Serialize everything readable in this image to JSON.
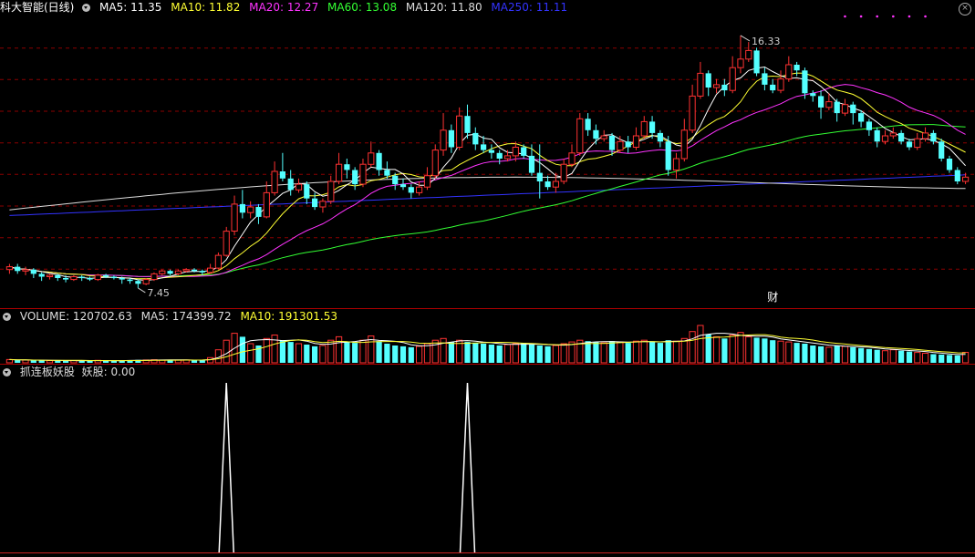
{
  "header": {
    "title": "科大智能(日线)",
    "ma": [
      {
        "label": "MA5: 11.35",
        "color": "#ffffff"
      },
      {
        "label": "MA10: 11.82",
        "color": "#ffff33"
      },
      {
        "label": "MA20: 12.27",
        "color": "#ff33ff"
      },
      {
        "label": "MA60: 13.08",
        "color": "#33ff33"
      },
      {
        "label": "MA120: 11.80",
        "color": "#dddddd"
      },
      {
        "label": "MA250: 11.11",
        "color": "#3333ff"
      }
    ],
    "close_symbol": "×"
  },
  "price_panel": {
    "high_marker": "16.33",
    "low_marker": "7.45",
    "event_marker": "财"
  },
  "volume_panel": {
    "label": "VOLUME: 120702.63",
    "ma5": "MA5: 174399.72",
    "ma10": "MA10: 191301.53"
  },
  "indicator_panel": {
    "name": "抓连板妖股",
    "value": "妖股: 0.00"
  },
  "colors": {
    "up": "#ff3232",
    "down": "#54ffff",
    "grid": "#8b0000",
    "ma5": "#ffffff",
    "ma10": "#ffff33",
    "ma20": "#ff33ff",
    "ma60": "#33ff33",
    "ma120": "#dddddd",
    "ma250": "#3333ff"
  },
  "chart_data": {
    "type": "candlestick",
    "ylim": [
      7.0,
      17.0
    ],
    "candles": [
      [
        8.1,
        8.2,
        8.3,
        7.95
      ],
      [
        8.2,
        8.05,
        8.3,
        7.95
      ],
      [
        8.05,
        8.1,
        8.2,
        7.9
      ],
      [
        8.1,
        7.95,
        8.15,
        7.8
      ],
      [
        7.95,
        7.85,
        8.0,
        7.7
      ],
      [
        7.85,
        7.9,
        7.95,
        7.75
      ],
      [
        7.9,
        7.8,
        7.95,
        7.7
      ],
      [
        7.8,
        7.75,
        7.9,
        7.65
      ],
      [
        7.75,
        7.85,
        7.9,
        7.7
      ],
      [
        7.85,
        7.8,
        7.9,
        7.7
      ],
      [
        7.8,
        7.75,
        7.85,
        7.7
      ],
      [
        7.75,
        7.9,
        7.95,
        7.7
      ],
      [
        7.9,
        7.85,
        7.95,
        7.8
      ],
      [
        7.85,
        7.8,
        7.9,
        7.75
      ],
      [
        7.8,
        7.75,
        7.85,
        7.6
      ],
      [
        7.75,
        7.7,
        7.8,
        7.6
      ],
      [
        7.7,
        7.6,
        7.75,
        7.45
      ],
      [
        7.6,
        7.75,
        7.8,
        7.55
      ],
      [
        7.75,
        7.95,
        8.0,
        7.7
      ],
      [
        7.95,
        8.05,
        8.1,
        7.9
      ],
      [
        8.05,
        7.95,
        8.1,
        7.9
      ],
      [
        7.95,
        8.05,
        8.1,
        7.9
      ],
      [
        8.05,
        8.1,
        8.15,
        8.0
      ],
      [
        8.1,
        8.05,
        8.15,
        8.0
      ],
      [
        8.05,
        8.0,
        8.1,
        7.9
      ],
      [
        8.0,
        8.15,
        8.3,
        7.95
      ],
      [
        8.15,
        8.6,
        8.7,
        8.1
      ],
      [
        8.6,
        9.45,
        9.6,
        8.55
      ],
      [
        9.45,
        10.4,
        10.7,
        9.3
      ],
      [
        10.4,
        10.1,
        10.9,
        9.9
      ],
      [
        10.1,
        10.3,
        10.5,
        9.9
      ],
      [
        10.3,
        9.95,
        10.4,
        9.7
      ],
      [
        9.95,
        10.8,
        11.2,
        9.9
      ],
      [
        10.8,
        11.55,
        11.9,
        10.7
      ],
      [
        11.55,
        11.3,
        12.2,
        11.2
      ],
      [
        11.3,
        10.9,
        11.6,
        10.7
      ],
      [
        10.9,
        11.1,
        11.3,
        10.8
      ],
      [
        11.1,
        10.6,
        11.2,
        10.4
      ],
      [
        10.6,
        10.3,
        10.8,
        10.2
      ],
      [
        10.3,
        10.5,
        10.6,
        10.1
      ],
      [
        10.5,
        11.2,
        11.4,
        10.4
      ],
      [
        11.2,
        11.8,
        12.2,
        11.1
      ],
      [
        11.8,
        11.6,
        12.0,
        11.3
      ],
      [
        11.6,
        11.1,
        11.7,
        10.9
      ],
      [
        11.1,
        11.8,
        12.0,
        11.0
      ],
      [
        11.8,
        12.2,
        12.6,
        11.7
      ],
      [
        12.2,
        11.6,
        12.3,
        11.4
      ],
      [
        11.6,
        11.4,
        11.9,
        11.3
      ],
      [
        11.4,
        11.1,
        11.5,
        10.9
      ],
      [
        11.1,
        11.0,
        11.3,
        10.9
      ],
      [
        11.0,
        10.8,
        11.1,
        10.6
      ],
      [
        10.8,
        11.0,
        11.2,
        10.7
      ],
      [
        11.0,
        11.4,
        11.7,
        10.9
      ],
      [
        11.4,
        12.3,
        12.5,
        11.3
      ],
      [
        12.3,
        13.0,
        13.6,
        12.1
      ],
      [
        13.0,
        12.4,
        13.2,
        12.2
      ],
      [
        12.4,
        13.5,
        13.8,
        12.3
      ],
      [
        13.5,
        12.9,
        13.9,
        12.7
      ],
      [
        12.9,
        12.5,
        13.1,
        12.3
      ],
      [
        12.5,
        12.3,
        12.8,
        12.2
      ],
      [
        12.3,
        12.2,
        12.5,
        12.0
      ],
      [
        12.2,
        12.0,
        12.3,
        11.8
      ],
      [
        12.0,
        12.1,
        12.3,
        11.9
      ],
      [
        12.1,
        12.4,
        12.6,
        11.9
      ],
      [
        12.4,
        12.1,
        12.5,
        12.0
      ],
      [
        12.1,
        11.5,
        12.5,
        11.4
      ],
      [
        11.5,
        11.2,
        12.5,
        10.6
      ],
      [
        11.2,
        11.0,
        11.4,
        10.9
      ],
      [
        11.0,
        11.2,
        11.5,
        10.8
      ],
      [
        11.2,
        11.8,
        12.0,
        11.1
      ],
      [
        11.8,
        12.2,
        12.5,
        11.7
      ],
      [
        12.2,
        13.4,
        13.6,
        12.1
      ],
      [
        13.4,
        13.0,
        13.6,
        12.8
      ],
      [
        13.0,
        12.7,
        13.2,
        12.5
      ],
      [
        12.7,
        12.8,
        13.0,
        12.6
      ],
      [
        12.8,
        12.3,
        12.9,
        12.1
      ],
      [
        12.3,
        12.6,
        12.8,
        12.2
      ],
      [
        12.6,
        12.4,
        12.8,
        12.2
      ],
      [
        12.4,
        12.8,
        13.1,
        12.3
      ],
      [
        12.8,
        13.3,
        13.5,
        12.7
      ],
      [
        13.3,
        12.9,
        13.5,
        12.7
      ],
      [
        12.9,
        12.6,
        13.0,
        12.4
      ],
      [
        12.6,
        11.6,
        12.8,
        11.4
      ],
      [
        11.6,
        12.0,
        12.2,
        11.3
      ],
      [
        12.0,
        13.0,
        13.4,
        11.9
      ],
      [
        13.0,
        14.2,
        14.6,
        12.9
      ],
      [
        14.2,
        15.0,
        15.4,
        14.1
      ],
      [
        15.0,
        14.5,
        15.1,
        14.2
      ],
      [
        14.5,
        14.6,
        14.8,
        14.3
      ],
      [
        14.6,
        14.4,
        14.8,
        14.2
      ],
      [
        14.4,
        15.2,
        15.6,
        14.3
      ],
      [
        15.2,
        15.5,
        16.33,
        15.0
      ],
      [
        15.5,
        15.8,
        16.1,
        15.4
      ],
      [
        15.8,
        15.0,
        15.9,
        14.9
      ],
      [
        15.0,
        14.6,
        15.2,
        14.4
      ],
      [
        14.6,
        14.4,
        14.8,
        14.3
      ],
      [
        14.4,
        14.8,
        15.1,
        14.3
      ],
      [
        14.8,
        15.3,
        15.6,
        14.7
      ],
      [
        15.3,
        15.1,
        15.4,
        14.9
      ],
      [
        15.1,
        14.3,
        15.2,
        14.1
      ],
      [
        14.3,
        14.2,
        14.4,
        14.0
      ],
      [
        14.2,
        13.8,
        14.4,
        13.4
      ],
      [
        13.8,
        14.0,
        14.3,
        13.7
      ],
      [
        14.0,
        13.6,
        14.1,
        13.3
      ],
      [
        13.6,
        13.9,
        14.1,
        13.5
      ],
      [
        13.9,
        13.6,
        14.0,
        13.2
      ],
      [
        13.6,
        13.3,
        13.7,
        13.1
      ],
      [
        13.3,
        13.0,
        13.4,
        12.8
      ],
      [
        13.0,
        12.6,
        13.1,
        12.4
      ],
      [
        12.6,
        12.8,
        13.0,
        12.5
      ],
      [
        12.8,
        12.9,
        13.1,
        12.7
      ],
      [
        12.9,
        12.6,
        13.0,
        12.5
      ],
      [
        12.6,
        12.4,
        12.7,
        12.3
      ],
      [
        12.4,
        12.7,
        12.9,
        12.3
      ],
      [
        12.7,
        12.9,
        13.1,
        12.6
      ],
      [
        12.9,
        12.6,
        13.0,
        12.5
      ],
      [
        12.6,
        12.0,
        12.7,
        11.9
      ],
      [
        12.0,
        11.6,
        12.1,
        11.5
      ],
      [
        11.6,
        11.2,
        11.7,
        11.1
      ],
      [
        11.2,
        11.35,
        11.5,
        11.1
      ]
    ],
    "volume": [
      38000,
      30000,
      32000,
      28000,
      26000,
      25000,
      27000,
      24000,
      26000,
      25000,
      23000,
      28000,
      26000,
      24000,
      27000,
      30000,
      34000,
      33000,
      36000,
      32000,
      34000,
      31000,
      33000,
      30000,
      29000,
      60000,
      150000,
      260000,
      340000,
      300000,
      220000,
      200000,
      280000,
      320000,
      260000,
      240000,
      220000,
      210000,
      190000,
      200000,
      260000,
      300000,
      240000,
      230000,
      260000,
      310000,
      250000,
      220000,
      200000,
      190000,
      180000,
      190000,
      220000,
      260000,
      280000,
      240000,
      260000,
      240000,
      230000,
      220000,
      210000,
      200000,
      210000,
      220000,
      230000,
      210000,
      200000,
      190000,
      200000,
      220000,
      240000,
      260000,
      250000,
      240000,
      230000,
      250000,
      240000,
      230000,
      250000,
      260000,
      240000,
      230000,
      260000,
      250000,
      280000,
      360000,
      430000,
      330000,
      300000,
      280000,
      320000,
      350000,
      300000,
      290000,
      280000,
      260000,
      250000,
      240000,
      230000,
      220000,
      200000,
      190000,
      180000,
      200000,
      190000,
      180000,
      170000,
      160000,
      150000,
      140000,
      150000,
      140000,
      130000,
      120000,
      110000,
      100000,
      95000,
      90000,
      85000,
      120702.63
    ],
    "indicator_spikes": [
      27,
      57
    ],
    "indicator_ylim": [
      0,
      1
    ]
  }
}
